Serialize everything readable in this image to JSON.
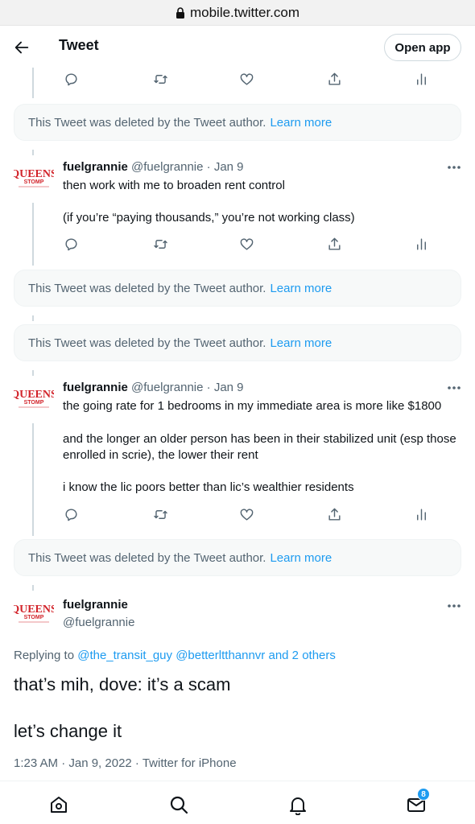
{
  "browser": {
    "url": "mobile.twitter.com",
    "lock_icon": "lock-icon"
  },
  "header": {
    "back_icon": "arrow-left-icon",
    "title": "Tweet",
    "open_app_label": "Open app"
  },
  "deleted_notice": {
    "text": "This Tweet was deleted by the Tweet author.",
    "learn_more": "Learn more"
  },
  "avatar_text": {
    "top": "QUEENS",
    "bottom": "STOMP"
  },
  "tweets": [
    {
      "name": "fuelgrannie",
      "handle": "@fuelgrannie",
      "separator": "·",
      "date": "Jan 9",
      "lines": [
        "then work with me to broaden rent control",
        "(if you’re “paying thousands,” you’re not working class)"
      ]
    },
    {
      "name": "fuelgrannie",
      "handle": "@fuelgrannie",
      "separator": "·",
      "date": "Jan 9",
      "lines": [
        "the going rate for 1 bedrooms in my immediate area is more like $1800",
        "and the longer an older person has been in their stabilized unit (esp those",
        "enrolled in scrie), the lower their rent",
        "i know the lic poors better than lic’s wealthier residents"
      ]
    }
  ],
  "main_tweet": {
    "name": "fuelgrannie",
    "handle": "@fuelgrannie",
    "replying_prefix": "Replying to",
    "replying_to": [
      "@the_transit_guy",
      "@betterltthannvr",
      "and 2 others"
    ],
    "text_lines": [
      "that’s mih, dove: it’s a scam",
      "let’s change it"
    ],
    "timestamp": "1:23 AM · Jan 9, 2022 · Twitter for iPhone"
  },
  "action_icons": [
    "reply-icon",
    "retweet-icon",
    "like-icon",
    "share-icon",
    "analytics-icon"
  ],
  "bottom_nav": {
    "items": [
      "home-icon",
      "search-icon",
      "notifications-icon",
      "messages-icon"
    ],
    "messages_badge": "8"
  },
  "colors": {
    "accent": "#1d9bf0",
    "secondary_text": "#536471",
    "avatar_red": "#d2232a"
  }
}
